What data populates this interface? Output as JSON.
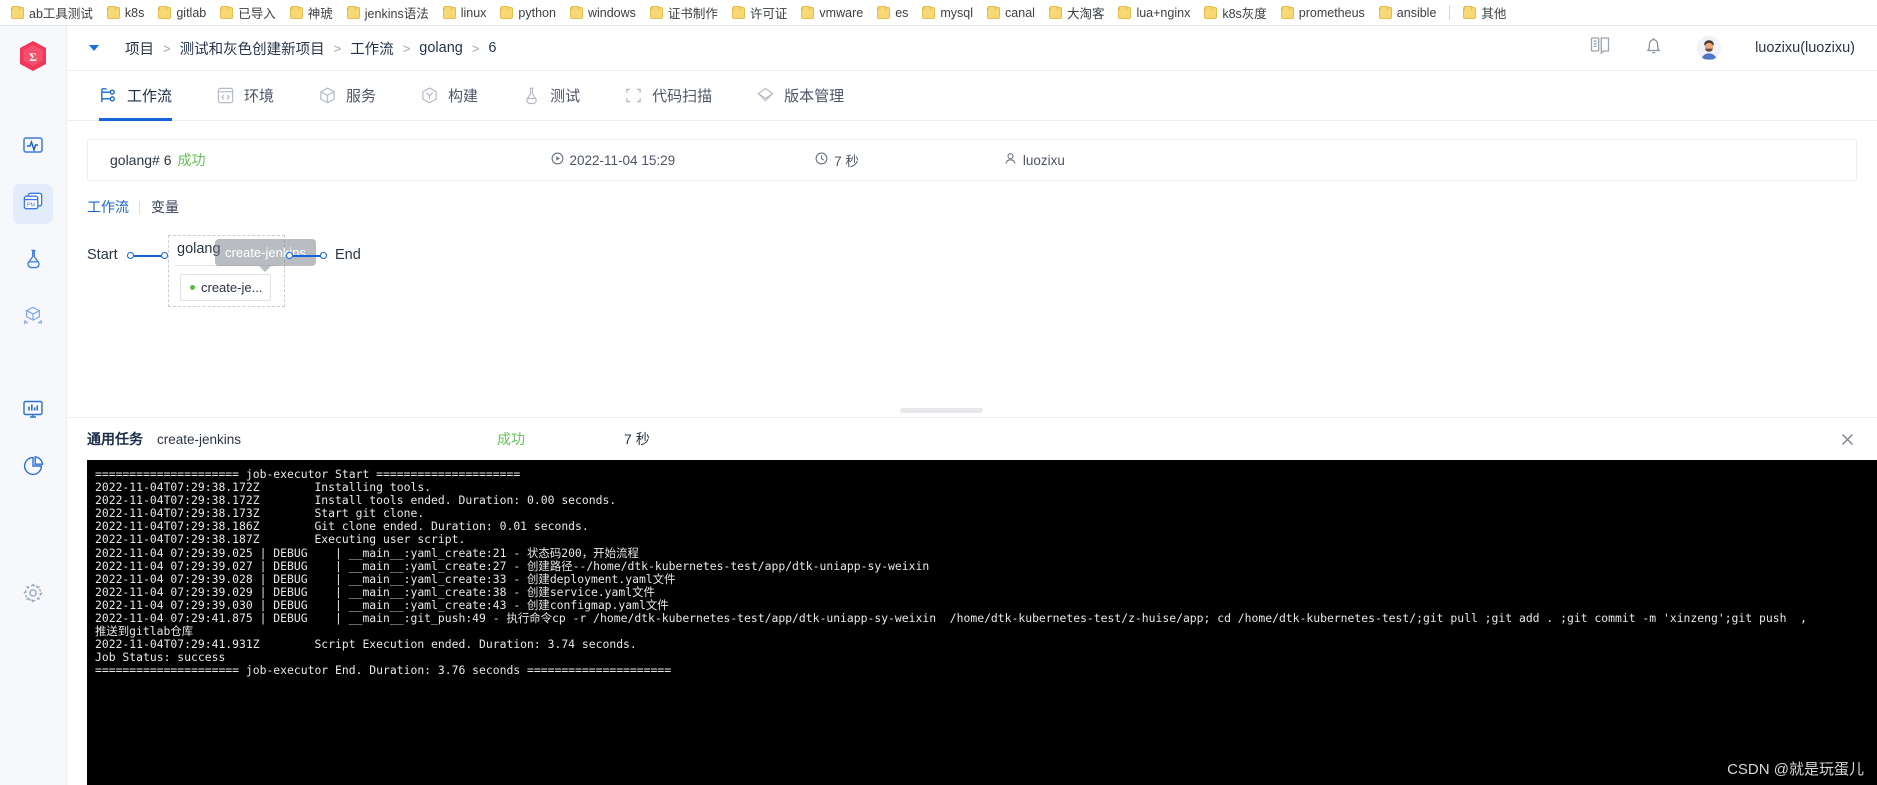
{
  "browser": {
    "bookmarks": [
      {
        "label": "ab工具测试",
        "icon": "folder-icon"
      },
      {
        "label": "k8s",
        "icon": "folder-icon"
      },
      {
        "label": "gitlab",
        "icon": "folder-icon"
      },
      {
        "label": "已导入",
        "icon": "folder-icon"
      },
      {
        "label": "神琥",
        "icon": "folder-icon"
      },
      {
        "label": "jenkins语法",
        "icon": "folder-icon"
      },
      {
        "label": "linux",
        "icon": "folder-icon"
      },
      {
        "label": "python",
        "icon": "folder-icon"
      },
      {
        "label": "windows",
        "icon": "folder-icon"
      },
      {
        "label": "证书制作",
        "icon": "folder-icon"
      },
      {
        "label": "许可证",
        "icon": "folder-icon"
      },
      {
        "label": "vmware",
        "icon": "folder-icon"
      },
      {
        "label": "es",
        "icon": "folder-icon"
      },
      {
        "label": "mysql",
        "icon": "folder-icon"
      },
      {
        "label": "canal",
        "icon": "folder-icon"
      },
      {
        "label": "大淘客",
        "icon": "folder-icon"
      },
      {
        "label": "lua+nginx",
        "icon": "folder-icon"
      },
      {
        "label": "k8s灰度",
        "icon": "folder-icon"
      },
      {
        "label": "prometheus",
        "icon": "folder-icon"
      },
      {
        "label": "ansible",
        "icon": "folder-icon"
      }
    ],
    "overflow_bookmark": {
      "label": "其他",
      "icon": "folder-icon"
    }
  },
  "rail": {
    "logo_name": "app-logo",
    "items": [
      {
        "name": "monitoring-icon",
        "active": false
      },
      {
        "name": "project-management-icon",
        "active": true
      },
      {
        "name": "testing-flask-icon",
        "active": false
      },
      {
        "name": "artifact-package-icon",
        "active": false
      },
      {
        "name": "dashboard-monitor-icon",
        "active": false
      },
      {
        "name": "reports-pie-icon",
        "active": false
      },
      {
        "name": "settings-gear-icon",
        "active": false
      }
    ]
  },
  "topbar": {
    "breadcrumb": [
      "项目",
      "测试和灰色创建新项目",
      "工作流",
      "golang",
      "6"
    ],
    "separator": ">",
    "docs_icon": "book-icon",
    "notification_icon": "bell-icon",
    "avatar_icon": "user-avatar",
    "username": "luozixu(luozixu)"
  },
  "tabs": [
    {
      "label": "工作流",
      "icon": "workflow-icon",
      "active": true
    },
    {
      "label": "环境",
      "icon": "code-environment-icon",
      "active": false
    },
    {
      "label": "服务",
      "icon": "service-cube-icon",
      "active": false
    },
    {
      "label": "构建",
      "icon": "build-hexagon-icon",
      "active": false
    },
    {
      "label": "测试",
      "icon": "test-flask-icon",
      "active": false
    },
    {
      "label": "代码扫描",
      "icon": "scan-frame-icon",
      "active": false
    },
    {
      "label": "版本管理",
      "icon": "version-diamond-icon",
      "active": false
    }
  ],
  "run": {
    "title": "golang# 6",
    "status": "成功",
    "status_color": "#61c454",
    "time_icon": "play-circle-icon",
    "time": "2022-11-04 15:29",
    "duration_icon": "clock-icon",
    "duration": "7 秒",
    "user_icon": "person-icon",
    "user": "luozixu"
  },
  "subtabs": [
    {
      "label": "工作流",
      "active": true
    },
    {
      "label": "变量",
      "active": false
    }
  ],
  "graph": {
    "start_label": "Start",
    "end_label": "End",
    "stage_name": "golang",
    "job_label": "create-je...",
    "job_status_color": "#5fb942",
    "tooltip": "create-jenkins"
  },
  "log_header": {
    "type_label": "通用任务",
    "job_name": "create-jenkins",
    "status": "成功",
    "duration": "7 秒",
    "close_icon": "close-icon"
  },
  "console": {
    "lines": [
      "===================== job-executor Start =====================",
      "2022-11-04T07:29:38.172Z        Installing tools.",
      "2022-11-04T07:29:38.172Z        Install tools ended. Duration: 0.00 seconds.",
      "2022-11-04T07:29:38.173Z        Start git clone.",
      "2022-11-04T07:29:38.186Z        Git clone ended. Duration: 0.01 seconds.",
      "2022-11-04T07:29:38.187Z        Executing user script.",
      "2022-11-04 07:29:39.025 | DEBUG    | __main__:yaml_create:21 - 状态码200，开始流程",
      "2022-11-04 07:29:39.027 | DEBUG    | __main__:yaml_create:27 - 创建路径--/home/dtk-kubernetes-test/app/dtk-uniapp-sy-weixin",
      "2022-11-04 07:29:39.028 | DEBUG    | __main__:yaml_create:33 - 创建deployment.yaml文件",
      "2022-11-04 07:29:39.029 | DEBUG    | __main__:yaml_create:38 - 创建service.yaml文件",
      "2022-11-04 07:29:39.030 | DEBUG    | __main__:yaml_create:43 - 创建configmap.yaml文件",
      "2022-11-04 07:29:41.875 | DEBUG    | __main__:git_push:49 - 执行命令cp -r /home/dtk-kubernetes-test/app/dtk-uniapp-sy-weixin  /home/dtk-kubernetes-test/z-huise/app; cd /home/dtk-kubernetes-test/;git pull ;git add . ;git commit -m 'xinzeng';git push  ,",
      "推送到gitlab仓库",
      "2022-11-04T07:29:41.931Z        Script Execution ended. Duration: 3.74 seconds.",
      "Job Status: success",
      "===================== job-executor End. Duration: 3.76 seconds ====================="
    ]
  },
  "watermark": "CSDN @就是玩蛋儿"
}
